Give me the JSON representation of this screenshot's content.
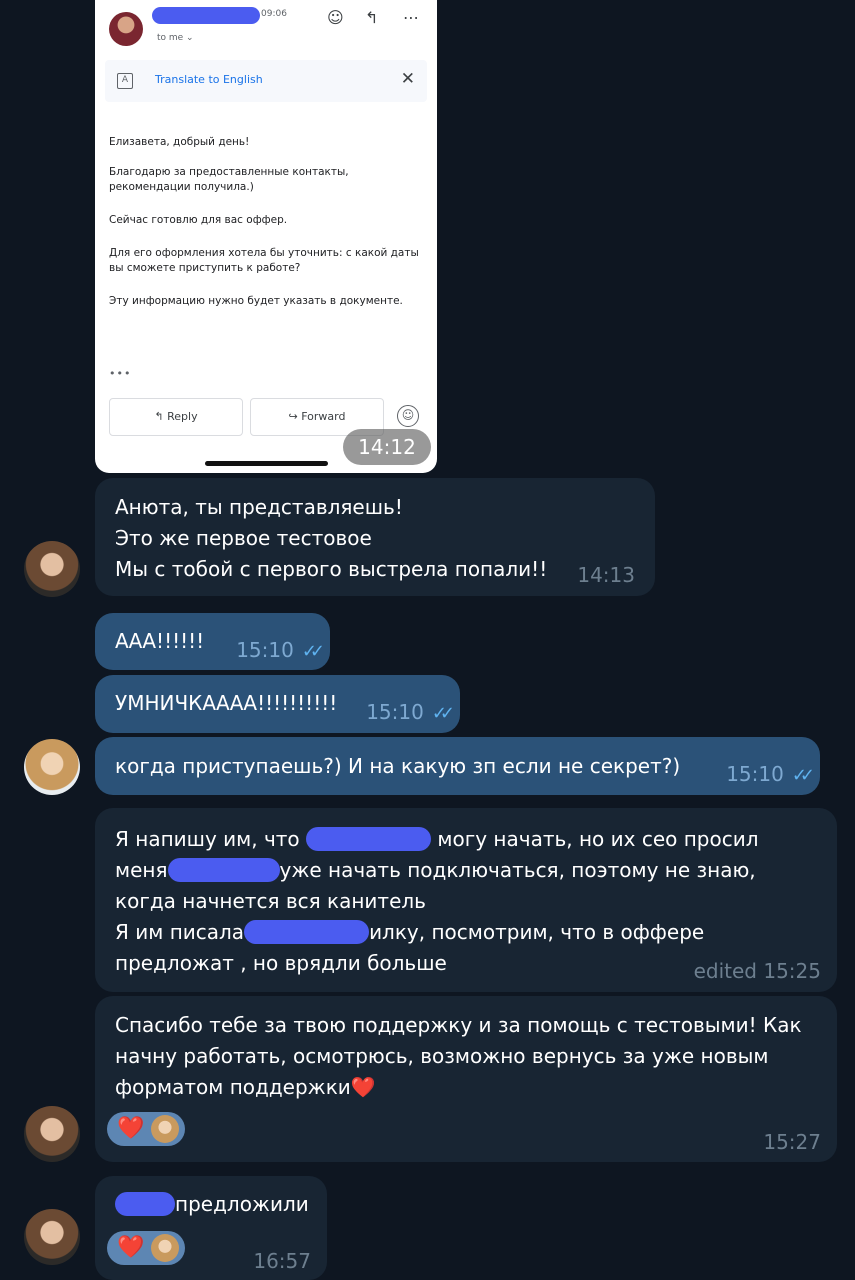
{
  "email": {
    "time": "09:06",
    "to": "to me ⌄",
    "translate_label": "Translate to English",
    "close": "✕",
    "paragraphs": [
      "Елизавета, добрый день!",
      "Благодарю за предоставленные контакты, рекомендации получила.)",
      "Сейчас готовлю для вас оффер.",
      "Для его оформления хотела бы уточнить: с какой даты вы сможете приступить к работе?",
      "Эту информацию нужно будет указать в документе."
    ],
    "dots": "•••",
    "reply_label": "↰  Reply",
    "forward_label": "↪  Forward",
    "photo_time": "14:12"
  },
  "messages": {
    "m1": {
      "lines": [
        "Анюта, ты представляешь!",
        "Это же первое тестовое",
        "Мы с тобой с первого выстрела попали!!"
      ],
      "time": "14:13"
    },
    "m2": {
      "text": "ААА!!!!!!",
      "time": "15:10"
    },
    "m3": {
      "text": "УМНИЧКАААА!!!!!!!!!!",
      "time": "15:10"
    },
    "m4": {
      "text": "когда приступаешь?) И на какую зп если не секрет?)",
      "time": "15:10"
    },
    "m5": {
      "l1a": "Я напишу им, что",
      "l1b": "могу начать, но их сео просил",
      "l2a": "меня",
      "l2b": "уже начать подключаться, поэтому не знаю,",
      "l3": "когда начнется вся канитель",
      "l4a": "Я им писала",
      "l4b": "илку, посмотрим, что в оффере",
      "l5": "предложат , но врядли больше",
      "meta": "edited 15:25"
    },
    "m6": {
      "l1": "Спасибо тебе за твою поддержку и за помощь с тестовыми! Как",
      "l2": "начну работать, осмотрюсь, возможно вернусь за уже новым",
      "l3": "форматом поддержки",
      "heart": "❤️",
      "reaction": "❤️",
      "time": "15:27"
    },
    "m7": {
      "text": "предложили",
      "reaction": "❤️",
      "time": "16:57"
    }
  },
  "read_ticks": "✓✓",
  "colors": {
    "background": "#0e1621",
    "incoming": "#182533",
    "outgoing": "#2b5278",
    "redaction": "#4b5cf0"
  }
}
